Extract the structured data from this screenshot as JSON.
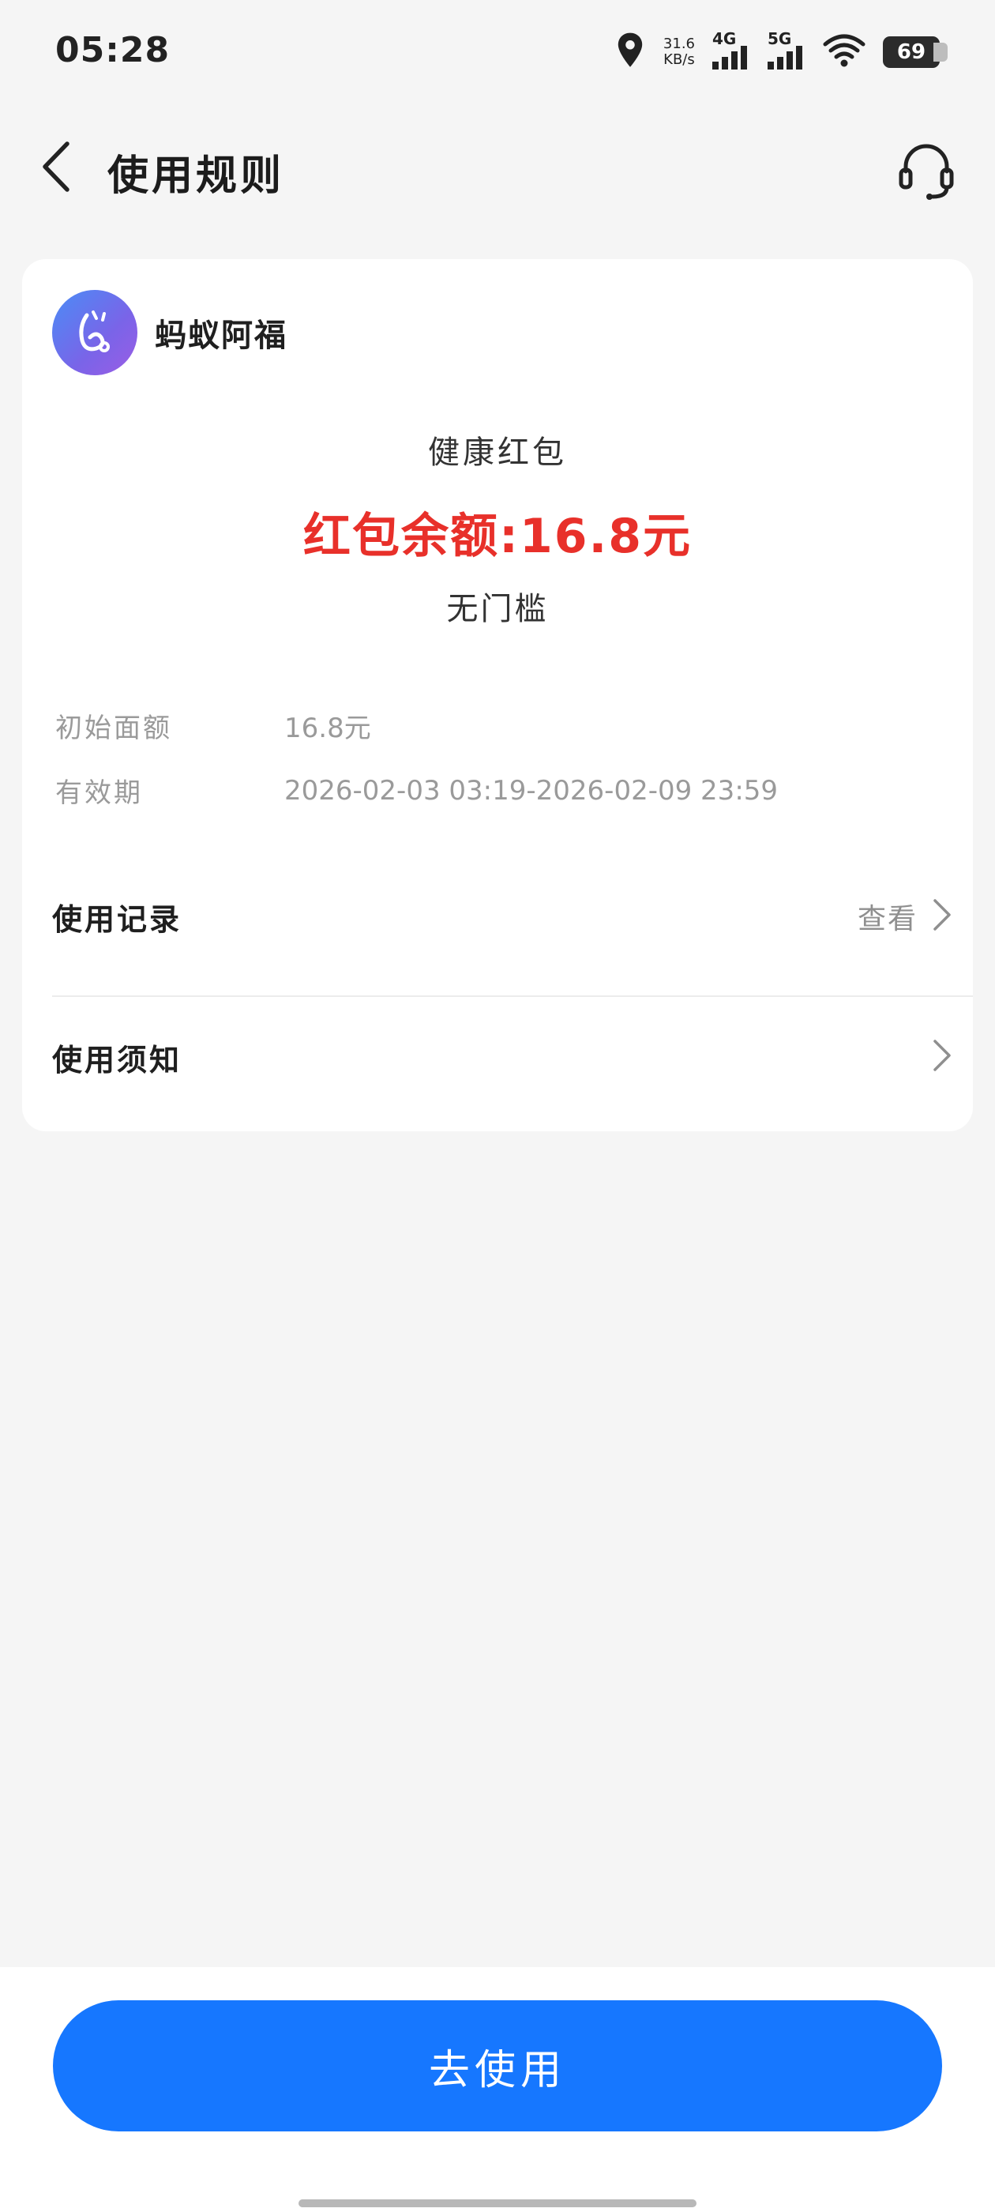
{
  "status_bar": {
    "time": "05:28",
    "net_speed_value": "31.6",
    "net_speed_unit": "KB/s",
    "signal_1": "4G",
    "signal_2": "5G",
    "battery": "69"
  },
  "header": {
    "title": "使用规则",
    "back_icon": "chevron-left-icon",
    "support_icon": "headset-icon"
  },
  "card": {
    "brand_name": "蚂蚁阿福",
    "coupon_type": "健康红包",
    "balance_text": "红包余额:16.8元",
    "threshold_text": "无门槛",
    "details": [
      {
        "label": "初始面额",
        "value": "16.8元"
      },
      {
        "label": "有效期",
        "value": "2026-02-03 03:19-2026-02-09 23:59"
      }
    ],
    "menu": [
      {
        "label": "使用记录",
        "link_text": "查看"
      },
      {
        "label": "使用须知",
        "link_text": ""
      }
    ]
  },
  "bottom": {
    "primary_button_label": "去使用"
  },
  "colors": {
    "accent": "#1677ff",
    "balance_red": "#e8302a",
    "background": "#f5f5f5"
  }
}
